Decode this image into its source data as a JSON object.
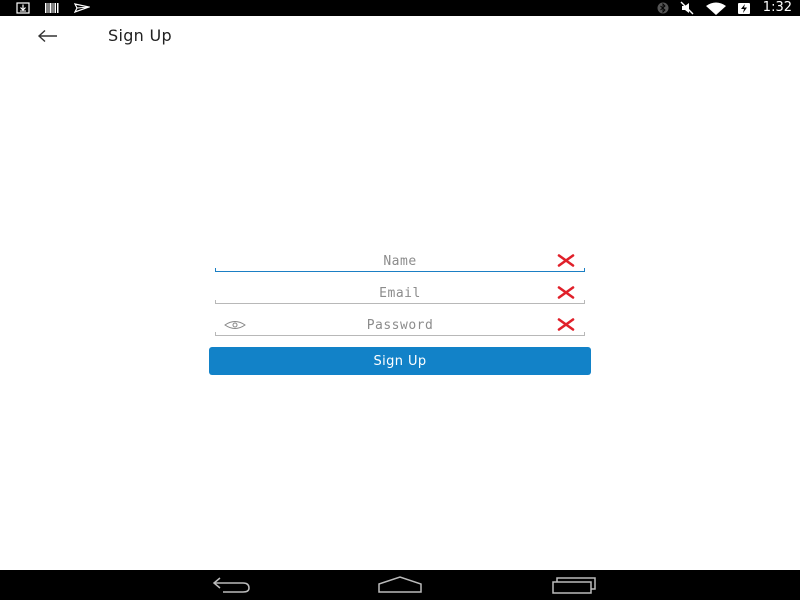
{
  "status_bar": {
    "time": "1:32",
    "left_icons": [
      "download-icon",
      "barcode-icon",
      "send-icon"
    ],
    "right_icons": [
      "bluetooth-icon",
      "mute-icon",
      "wifi-icon",
      "battery-charging-icon"
    ]
  },
  "header": {
    "title": "Sign Up",
    "back_icon": "arrow-left-icon"
  },
  "form": {
    "name": {
      "placeholder": "Name",
      "value": "",
      "clear_icon": "clear-icon"
    },
    "email": {
      "placeholder": "Email",
      "value": "",
      "clear_icon": "clear-icon"
    },
    "password": {
      "placeholder": "Password",
      "value": "",
      "visibility_icon": "eye-icon",
      "clear_icon": "clear-icon"
    },
    "submit_label": "Sign Up"
  },
  "nav_bar": {
    "icons": [
      "back-icon",
      "home-icon",
      "recents-icon"
    ]
  },
  "colors": {
    "accent": "#1282c8",
    "focus_underline": "#1b7fc4",
    "clear_icon": "#e0202a",
    "status_bar": "#000000"
  }
}
